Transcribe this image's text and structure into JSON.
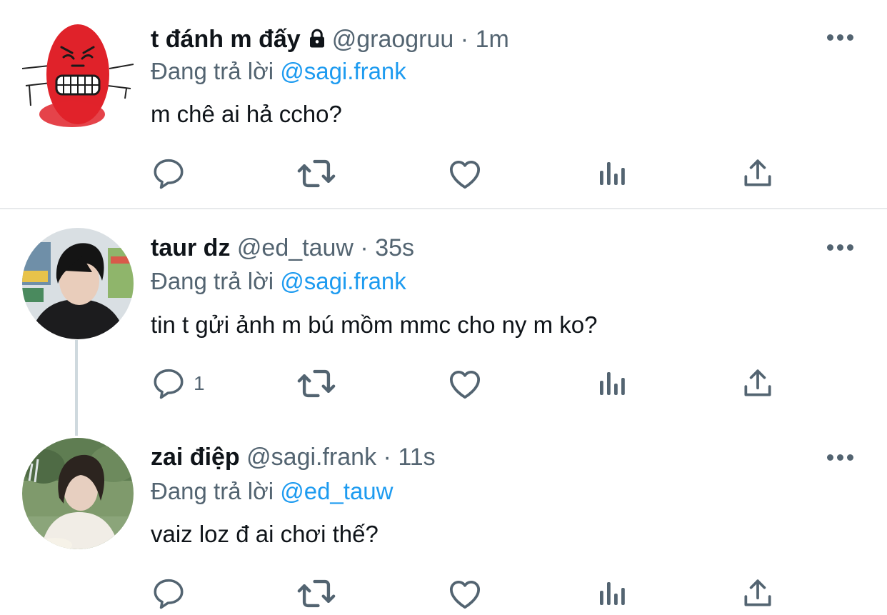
{
  "tweets": [
    {
      "display_name": "t đánh m đấy",
      "protected": true,
      "handle": "@graogruu",
      "separator": "·",
      "time": "1m",
      "replying_prefix": "Đang trả lời",
      "replying_to": "@sagi.frank",
      "text": "m chê ai hả ccho?",
      "reply_count": ""
    },
    {
      "display_name": "taur dz",
      "handle": "@ed_tauw",
      "separator": "·",
      "time": "35s",
      "replying_prefix": "Đang trả lời",
      "replying_to": "@sagi.frank",
      "text": "tin t gửi ảnh m bú mồm mmc cho ny m ko?",
      "reply_count": "1"
    },
    {
      "display_name": "zai điệp",
      "handle": "@sagi.frank",
      "separator": "·",
      "time": "11s",
      "replying_prefix": "Đang trả lời",
      "replying_to": "@ed_tauw",
      "text": "vaiz loz đ ai chơi thế?",
      "reply_count": ""
    }
  ],
  "icons": {
    "reply": "speech-bubble-icon",
    "retweet": "retweet-arrows-icon",
    "like": "heart-outline-icon",
    "views": "bar-chart-icon",
    "share": "share-upload-icon",
    "more": "three-dots-icon",
    "lock": "padlock-icon"
  },
  "colors": {
    "name": "#0f1419",
    "secondary": "#536471",
    "mention": "#1d9bf0",
    "divider": "#e7e9eb",
    "thread_line": "#cfd9de"
  }
}
